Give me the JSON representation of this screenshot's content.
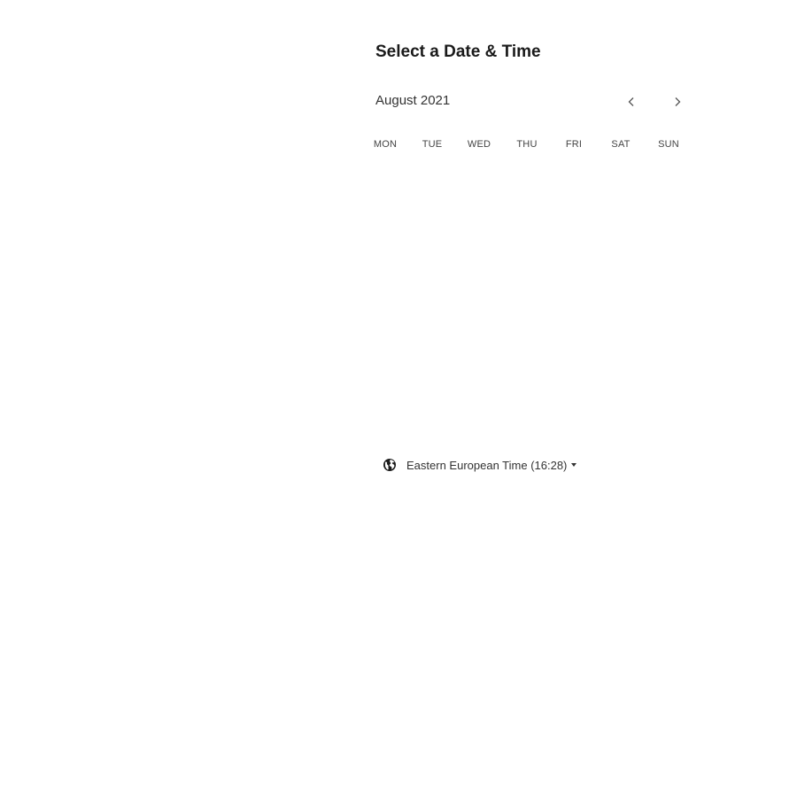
{
  "booking": {
    "title": "Select a Date & Time",
    "month_label": "August 2021",
    "prev_icon": "chevron-left-icon",
    "next_icon": "chevron-right-icon",
    "weekdays": [
      "MON",
      "TUE",
      "WED",
      "THU",
      "FRI",
      "SAT",
      "SUN"
    ],
    "timezone": {
      "icon": "globe-icon",
      "label": "Eastern European Time (16:28)",
      "dropdown_icon": "caret-down-icon"
    }
  }
}
